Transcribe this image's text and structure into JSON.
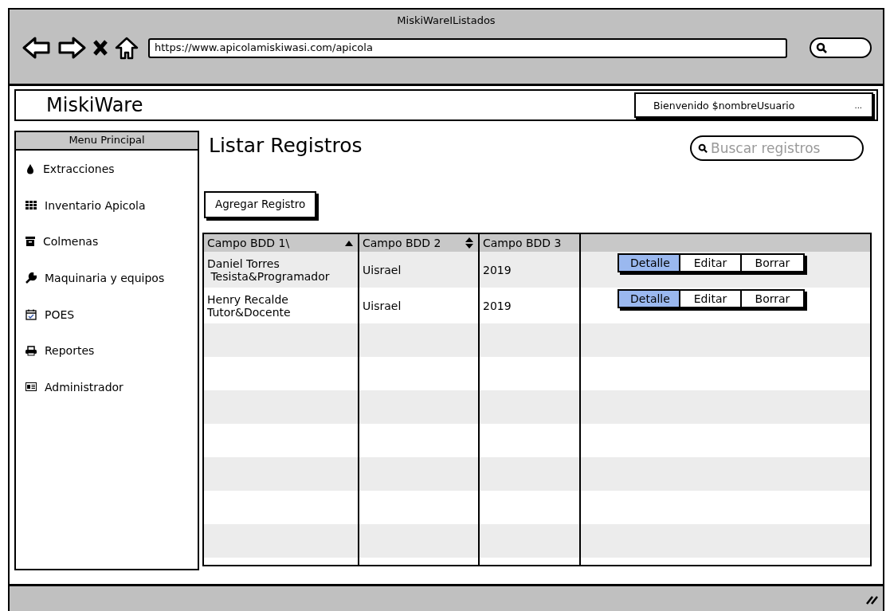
{
  "window": {
    "title": "MiskiWareIListados"
  },
  "browser": {
    "url": "https://www.apicolamiskiwasi.com/apicola"
  },
  "header": {
    "logo": "MiskiWare",
    "welcome": "Bienvenido $nombreUsuario",
    "more": "..."
  },
  "sidebar": {
    "title": "Menu Principal",
    "items": [
      {
        "label": "Extracciones",
        "kind": "drop"
      },
      {
        "label": "Inventario Apicola",
        "kind": "grid"
      },
      {
        "label": "Colmenas",
        "kind": "archive"
      },
      {
        "label": "Maquinaria y equipos",
        "kind": "wrench"
      },
      {
        "label": "POES",
        "kind": "calendar"
      },
      {
        "label": "Reportes",
        "kind": "printer"
      },
      {
        "label": "Administrador",
        "kind": "card"
      }
    ]
  },
  "main": {
    "title": "Listar Registros",
    "search": {
      "placeholder": "Buscar registros"
    },
    "add_button": "Agregar Registro"
  },
  "table": {
    "columns": [
      {
        "label": "Campo BDD 1\\",
        "kind": "sortasc"
      },
      {
        "label": "Campo BDD 2",
        "kind": "sortboth"
      },
      {
        "label": "Campo BDD 3",
        "kind": "plain"
      }
    ],
    "rows": [
      {
        "cells": [
          "Daniel Torres\n Tesista&Programador",
          "Uisrael",
          "2019"
        ],
        "actions": [
          {
            "label": "Detalle",
            "selected": true
          },
          {
            "label": "Editar",
            "selected": false
          },
          {
            "label": "Borrar",
            "selected": false
          }
        ]
      },
      {
        "cells": [
          "Henry Recalde\nTutor&Docente",
          "Uisrael",
          "2019"
        ],
        "actions": [
          {
            "label": "Detalle",
            "selected": true
          },
          {
            "label": "Editar",
            "selected": false
          },
          {
            "label": "Borrar",
            "selected": false
          }
        ]
      }
    ]
  }
}
